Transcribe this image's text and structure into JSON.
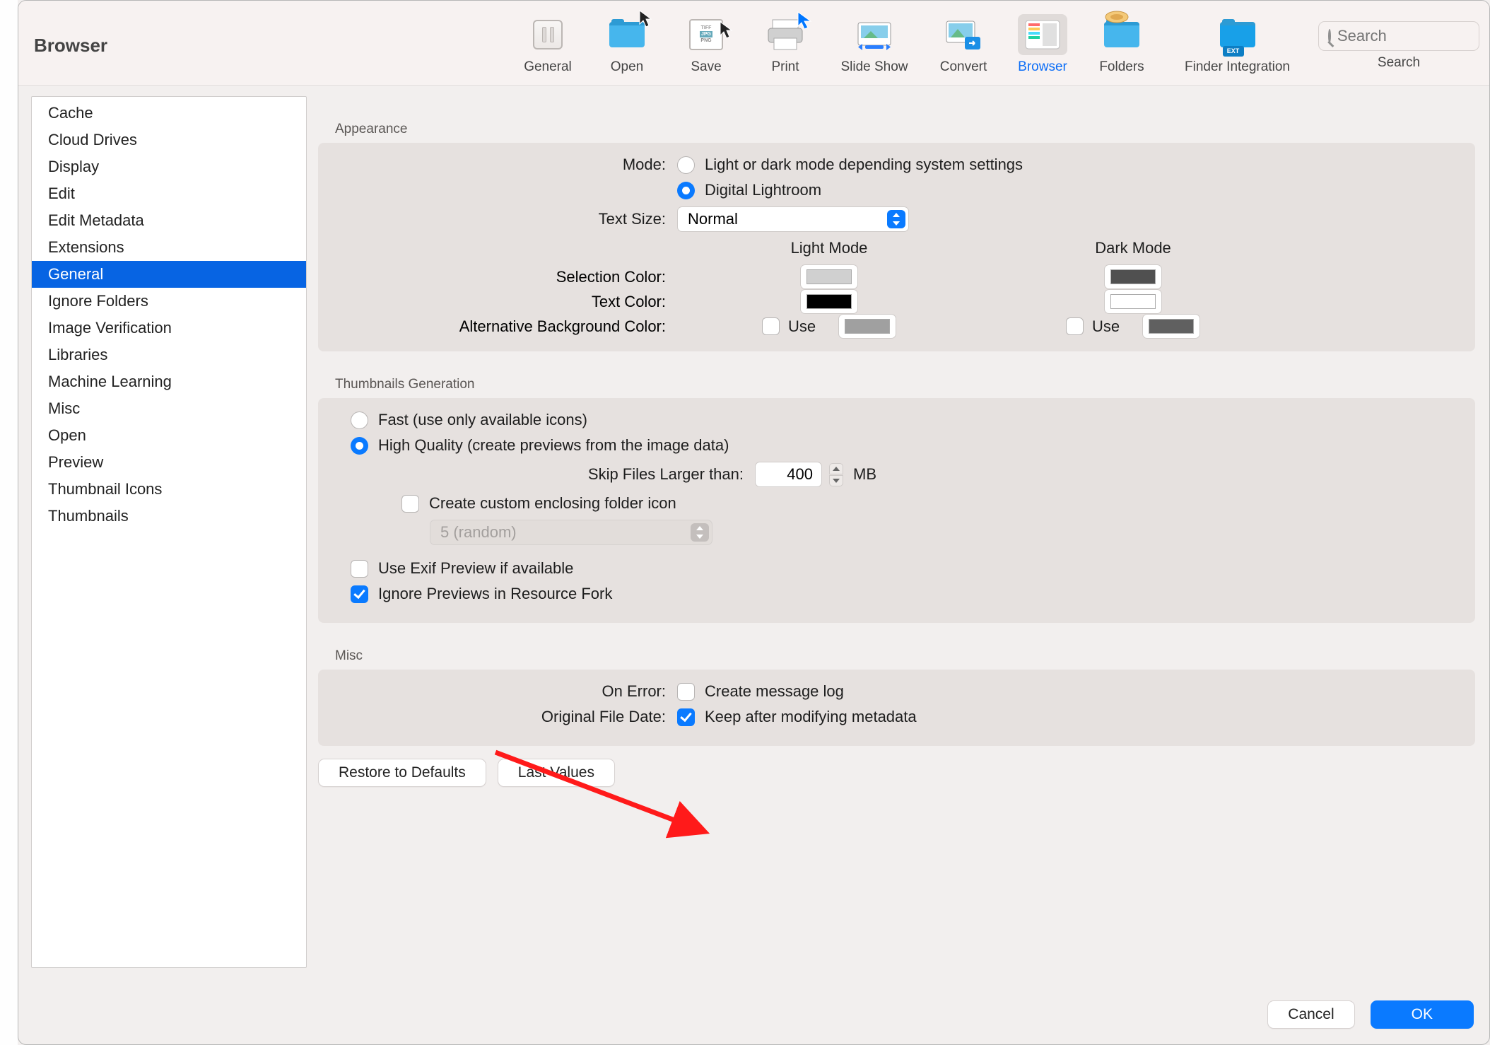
{
  "title": "Browser",
  "toolbar": [
    {
      "id": "general",
      "label": "General"
    },
    {
      "id": "open",
      "label": "Open"
    },
    {
      "id": "save",
      "label": "Save"
    },
    {
      "id": "print",
      "label": "Print"
    },
    {
      "id": "slideshow",
      "label": "Slide Show"
    },
    {
      "id": "convert",
      "label": "Convert"
    },
    {
      "id": "browser",
      "label": "Browser",
      "selected": true
    },
    {
      "id": "folders",
      "label": "Folders"
    },
    {
      "id": "finder",
      "label": "Finder Integration"
    }
  ],
  "search_placeholder": "Search",
  "search_label": "Search",
  "sidebar": [
    "Cache",
    "Cloud Drives",
    "Display",
    "Edit",
    "Edit Metadata",
    "Extensions",
    "General",
    "Ignore Folders",
    "Image Verification",
    "Libraries",
    "Machine Learning",
    "Misc",
    "Open",
    "Preview",
    "Thumbnail Icons",
    "Thumbnails"
  ],
  "sidebar_selected": "General",
  "appearance": {
    "title": "Appearance",
    "mode_label": "Mode:",
    "mode_opt1": "Light or dark mode depending system settings",
    "mode_opt2": "Digital Lightroom",
    "mode_selected": 2,
    "textsize_label": "Text Size:",
    "textsize_value": "Normal",
    "light_header": "Light Mode",
    "dark_header": "Dark Mode",
    "selcolor_label": "Selection Color:",
    "textcolor_label": "Text Color:",
    "altbg_label": "Alternative Background Color:",
    "use_label": "Use",
    "colors": {
      "light_sel": "#d0d0d0",
      "light_text": "#000000",
      "light_alt": "#a0a0a0",
      "dark_sel": "#505050",
      "dark_text": "#ffffff",
      "dark_alt": "#606060"
    }
  },
  "thumbs": {
    "title": "Thumbnails Generation",
    "opt_fast": "Fast (use only available icons)",
    "opt_hq": "High Quality (create previews from the image data)",
    "selected": 2,
    "skip_label": "Skip Files Larger than:",
    "skip_value": "400",
    "skip_unit": "MB",
    "custom_icon_label": "Create custom enclosing folder icon",
    "custom_icon_select": "5 (random)",
    "exif_label": "Use Exif Preview if available",
    "ignore_rsrc_label": "Ignore Previews in Resource Fork"
  },
  "misc": {
    "title": "Misc",
    "onerror_label": "On Error:",
    "onerror_opt": "Create message log",
    "origdate_label": "Original File Date:",
    "origdate_opt": "Keep after modifying metadata"
  },
  "restore_btn": "Restore to Defaults",
  "lastvals_btn": "Last Values",
  "cancel_btn": "Cancel",
  "ok_btn": "OK"
}
